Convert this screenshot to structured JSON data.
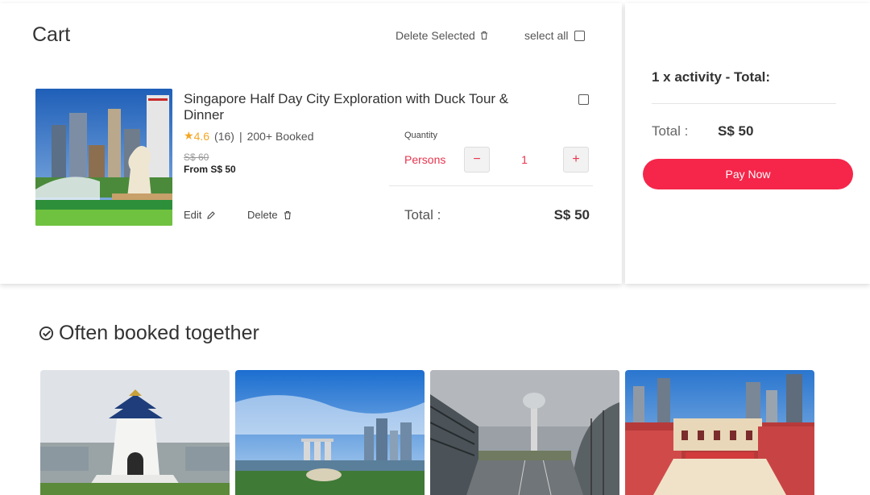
{
  "cart": {
    "title": "Cart",
    "delete_selected_label": "Delete Selected",
    "select_all_label": "select all",
    "item": {
      "title": "Singapore Half Day City Exploration with Duck Tour & Dinner",
      "rating_score": "4.6",
      "rating_count": "(16)",
      "separator": "|",
      "booked": "200+ Booked",
      "old_price": "S$ 60",
      "from_price": "From S$ 50",
      "quantity_label": "Quantity",
      "persons_label": "Persons",
      "minus_label": "−",
      "quantity_value": "1",
      "plus_label": "+",
      "edit_label": "Edit",
      "delete_label": "Delete",
      "total_label": "Total :",
      "total_value": "S$ 50"
    }
  },
  "summary": {
    "title": "1 x activity - Total:",
    "total_label": "Total :",
    "total_value": "S$ 50",
    "pay_label": "Pay Now"
  },
  "often_booked": {
    "title": "Often booked together"
  },
  "colors": {
    "accent": "#f5264a",
    "star": "#f5a623"
  }
}
